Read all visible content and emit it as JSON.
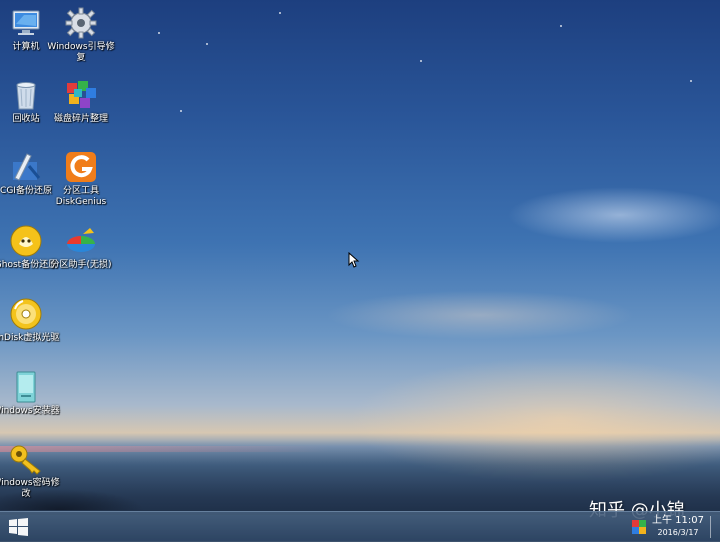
{
  "desktop": {
    "icons": [
      {
        "label": "计算机",
        "icon": "computer-icon"
      },
      {
        "label": "Windows引导修复",
        "icon": "gear-icon"
      },
      {
        "label": "回收站",
        "icon": "recycle-bin-icon"
      },
      {
        "label": "磁盘碎片整理",
        "icon": "defrag-cubes-icon"
      },
      {
        "label": "CGI备份还原",
        "icon": "cgi-backup-icon"
      },
      {
        "label": "分区工具DiskGenius",
        "icon": "diskgenius-icon"
      },
      {
        "label": "Ghost备份还原",
        "icon": "ghost-icon"
      },
      {
        "label": "分区助手(无损)",
        "icon": "partition-assistant-icon"
      },
      {
        "label": "ImDisk虚拟光驱",
        "icon": "virtual-disc-icon"
      },
      {
        "label": "Windows安装器",
        "icon": "windows-installer-icon"
      },
      {
        "label": "Windows密码修改",
        "icon": "key-icon"
      }
    ]
  },
  "taskbar": {
    "start_icon": "windows-logo-icon",
    "tray_icon": "network-flag-icon",
    "clock": {
      "time": "上午 11:07",
      "date": "2016/3/17"
    }
  },
  "watermark": {
    "text": "知乎 @小锦"
  },
  "colors": {
    "sky_top": "#1d3f7f",
    "sky_mid": "#3e73b2",
    "horizon": "#d6c7b2",
    "taskbar": "#3f5d82"
  }
}
